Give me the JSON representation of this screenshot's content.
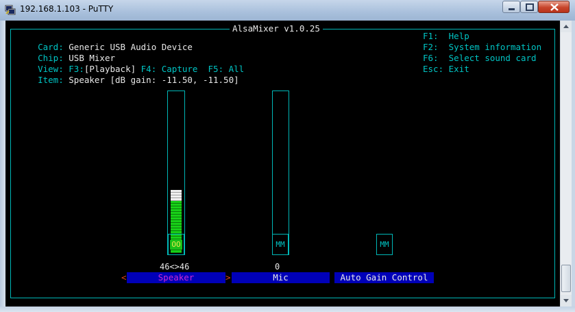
{
  "window": {
    "title": "192.168.1.103 - PuTTY"
  },
  "header": {
    "title": "AlsaMixer v1.0.25",
    "card_label": "Card:",
    "card_value": "Generic USB Audio Device",
    "chip_label": "Chip:",
    "chip_value": "USB Mixer",
    "view_label": "View:",
    "view_f3": "F3:",
    "view_playback": "[Playback]",
    "view_f4": "F4: Capture",
    "view_f5": "F5: All",
    "item_label": "Item:",
    "item_value": "Speaker [dB gain: -11.50, -11.50]"
  },
  "help": [
    {
      "key": "F1:",
      "text": "Help"
    },
    {
      "key": "F2:",
      "text": "System information"
    },
    {
      "key": "F6:",
      "text": "Select sound card"
    },
    {
      "key": "Esc:",
      "text": "Exit"
    }
  ],
  "controls": [
    {
      "name": "Speaker",
      "value_label": "46<>46",
      "mute_label": "OO",
      "level": 46,
      "selected": true
    },
    {
      "name": "Mic",
      "value_label": "0",
      "mute_label": "MM",
      "level": 0,
      "selected": false
    },
    {
      "name": "Auto Gain Control",
      "value_label": "",
      "mute_label": "MM",
      "selected": false
    }
  ],
  "selection_left": "<",
  "selection_right": ">",
  "colors": {
    "terminal_bg": "#000000",
    "cyan": "#00c4c4",
    "yellow": "#e8e84c",
    "blue": "#0000b8",
    "green": "#18d018",
    "magenta": "#d02ad0",
    "red": "#e04020"
  }
}
